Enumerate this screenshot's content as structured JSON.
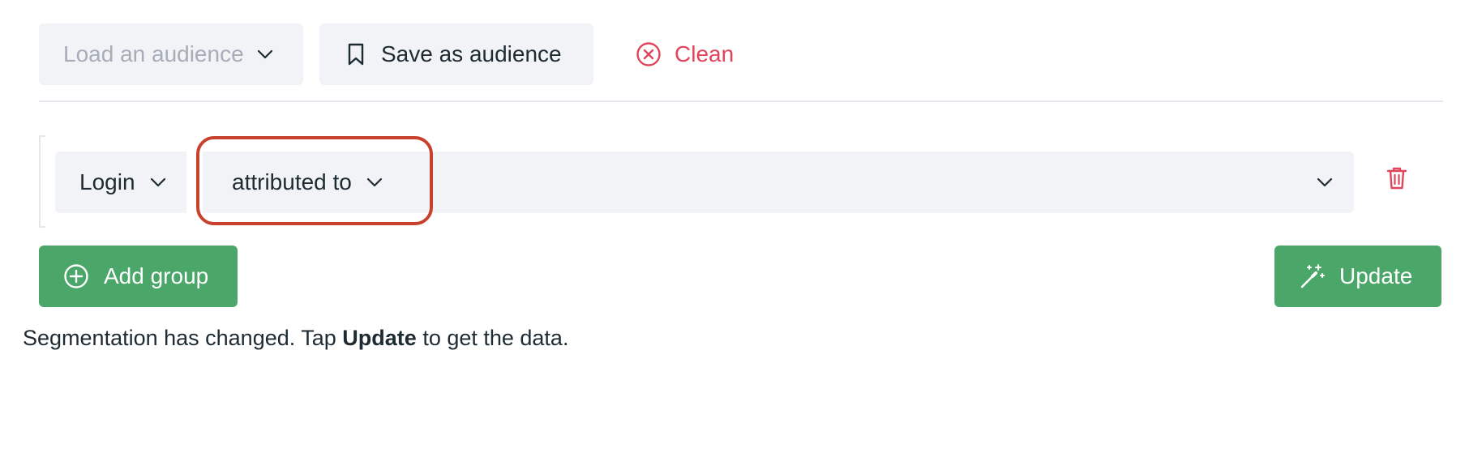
{
  "toolbar": {
    "load_audience_placeholder": "Load an audience",
    "save_audience_label": "Save as audience",
    "clean_label": "Clean"
  },
  "segment": {
    "event_label": "Login",
    "operator_label": "attributed to",
    "value_label": ""
  },
  "actions": {
    "add_group_label": "Add group",
    "update_label": "Update"
  },
  "status": {
    "prefix": "Segmentation has changed. Tap ",
    "emphasis": "Update",
    "suffix": " to get the data."
  },
  "colors": {
    "accent_green": "#4ba66a",
    "danger": "#e0455c",
    "highlight": "#c8412c",
    "field_bg": "#f1f3f7"
  }
}
